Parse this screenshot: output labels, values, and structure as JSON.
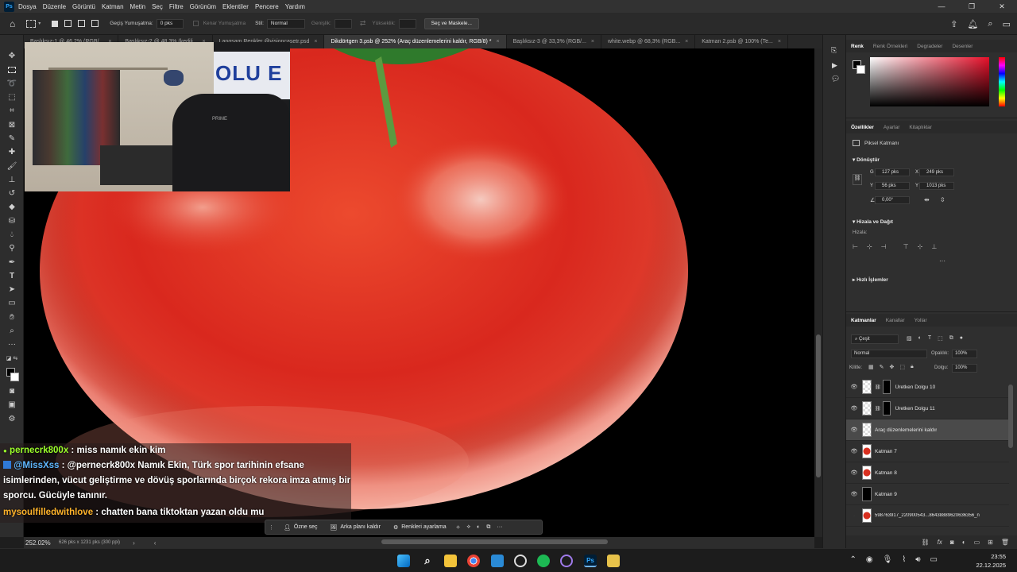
{
  "app": {
    "logo": "Ps"
  },
  "menu": [
    "Dosya",
    "Düzenle",
    "Görüntü",
    "Katman",
    "Metin",
    "Seç",
    "Filtre",
    "Görünüm",
    "Eklentiler",
    "Pencere",
    "Yardım"
  ],
  "window_controls": [
    "—",
    "❐",
    "✕"
  ],
  "options_bar": {
    "feather_label": "Geçiş Yumuşatma:",
    "feather_value": "0 pks",
    "antialias_label": "Kenar Yumuşatma",
    "style_label": "Stil:",
    "style_value": "Normal",
    "width_label": "Genişlik:",
    "height_label": "Yükseklik:",
    "select_mask_button": "Seç ve Maskele..."
  },
  "doc_tabs": [
    {
      "label": "Başlıksız-1 @ 46,2% (RGB/...",
      "active": false
    },
    {
      "label": "Başlıksız-2 @ 48,3% (kedili...",
      "active": false
    },
    {
      "label": "Langsam Renkler @visioncasetr.psd",
      "active": false
    },
    {
      "label": "Dikdörtgen 3.psb @ 252% (Araç düzenlemelerini kaldır, RGB/8) *",
      "active": true
    },
    {
      "label": "Başlıksız-3 @ 33,3% (RGB/...",
      "active": false
    },
    {
      "label": "white.webp @ 68,3% (RGB...",
      "active": false
    },
    {
      "label": "Katman 2.psb @ 100% (Te...",
      "active": false
    }
  ],
  "status": {
    "zoom": "252.02%",
    "doc_size": "626 pks x 1231 pks (300 ppi)"
  },
  "color_panel": {
    "tabs": [
      "Renk",
      "Renk Örnekleri",
      "Degradeler",
      "Desenler"
    ],
    "accent": "#e8102a"
  },
  "properties": {
    "tabs": [
      "Özellikler",
      "Ayarlar",
      "Kitaplıklar"
    ],
    "kind": "Piksel Katmanı",
    "transform_title": "Dönüştür",
    "w_label": "G",
    "w": "127 pks",
    "x_label": "X",
    "x": "249 pks",
    "h_label": "Y",
    "h": "56 pks",
    "y_label": "Y",
    "y": "1013 pks",
    "angle": "0,00°",
    "align_title": "Hizala ve Dağıt",
    "align_sub": "Hizala:",
    "quick_title": "Hızlı İşlemler"
  },
  "layers_panel": {
    "tabs": [
      "Katmanlar",
      "Kanallar",
      "Yollar"
    ],
    "filter": "Çeşit",
    "blend_mode": "Normal",
    "opacity_label": "Opaklık:",
    "opacity": "100%",
    "lock_label": "Kilitle:",
    "fill_label": "Dolgu:",
    "fill": "100%",
    "layers": [
      {
        "name": "Üretken Dolgu 10",
        "mask": true,
        "selected": false,
        "thumb": "checker"
      },
      {
        "name": "Üretken Dolgu 11",
        "mask": true,
        "selected": false,
        "thumb": "checker"
      },
      {
        "name": "Araç düzenlemelerini kaldır",
        "mask": false,
        "selected": true,
        "thumb": "checker"
      },
      {
        "name": "Katman 7",
        "mask": false,
        "selected": false,
        "thumb": "tomato"
      },
      {
        "name": "Katman 8",
        "mask": false,
        "selected": false,
        "thumb": "tomato"
      },
      {
        "name": "Katman 9",
        "mask": false,
        "selected": false,
        "thumb": "black"
      },
      {
        "name": "598763917_220900543...8643888962063635​6_n",
        "mask": false,
        "selected": false,
        "thumb": "tomato"
      }
    ]
  },
  "context_bar": {
    "subject": "Özne seç",
    "remove_bg": "Arka planı kaldır",
    "colors": "Renkleri ayarlama"
  },
  "chat": [
    {
      "user": "pernecrk800x",
      "user_color": "#9bff2a",
      "message": " : miss namık ekin kim"
    },
    {
      "user": "@MissXss",
      "user_color": "#5fb8ff",
      "message": " : @pernecrk800x Namık Ekin, Türk spor tarihinin efsane isimlerinden, vücut geliştirme ve dövüş sporlarında birçok rekora imza atmış bir sporcu. Gücüyle tanınır."
    },
    {
      "user": "mysoulfilledwithlove",
      "user_color": "#ffb32a",
      "message": " : chatten bana tiktoktan yazan oldu mu"
    }
  ],
  "webcam": {
    "jersey_text": "OLU E",
    "brand": "PRIME"
  },
  "taskbar": {
    "time": "23:55",
    "date": "22.12.2025"
  }
}
